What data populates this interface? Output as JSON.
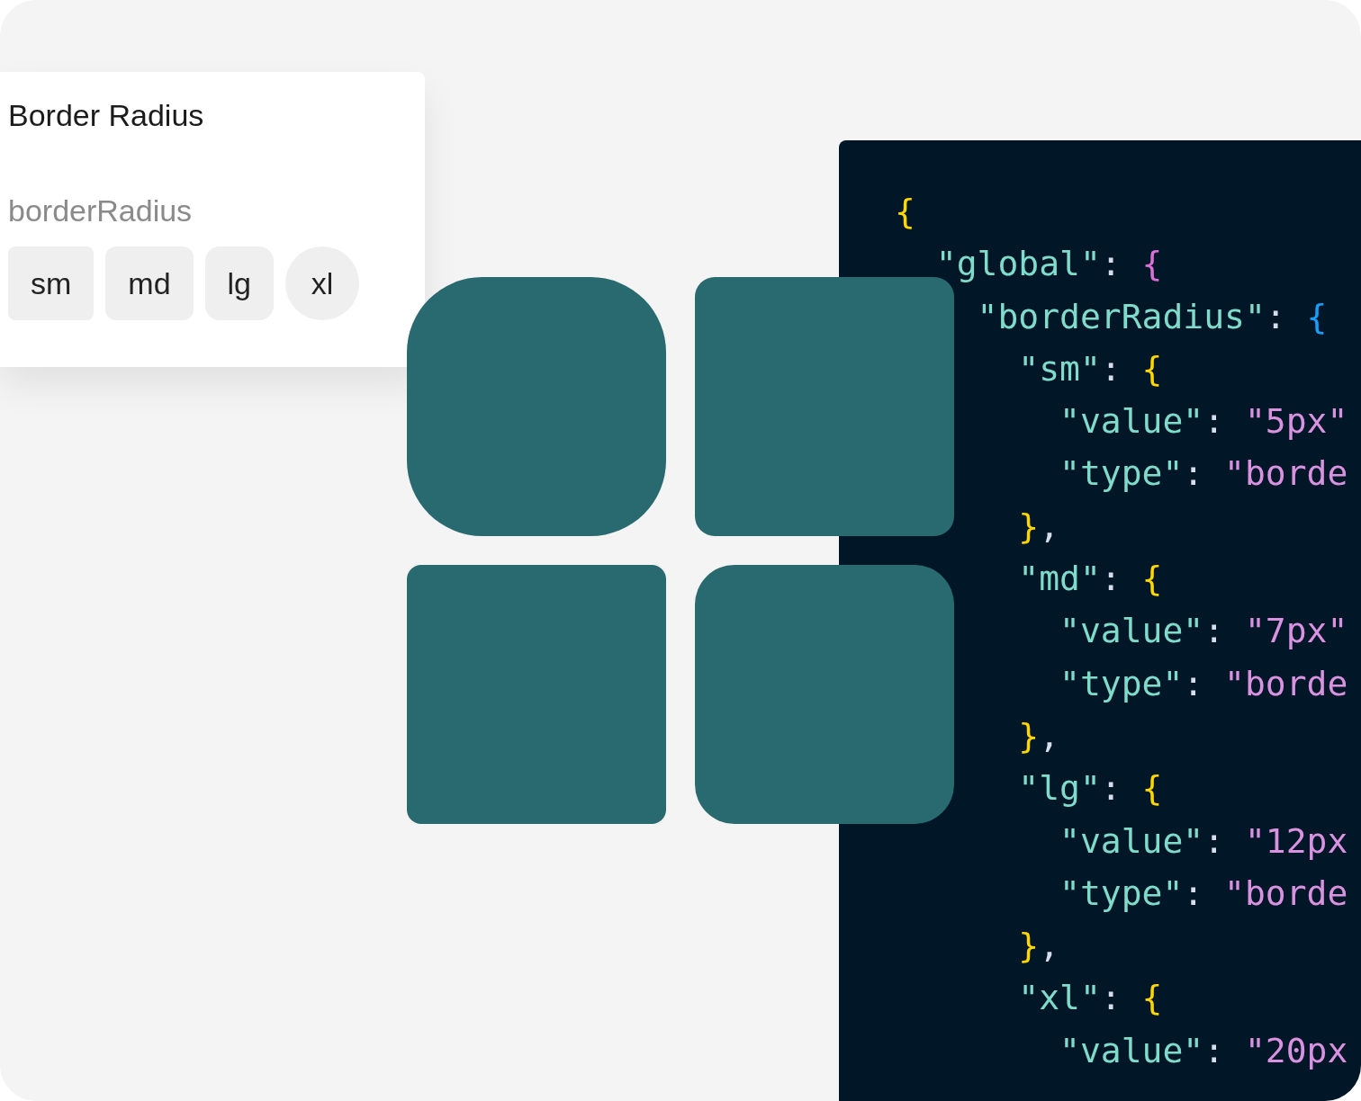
{
  "card": {
    "title": "Border Radius",
    "token_name": "borderRadius",
    "options": [
      {
        "label": "sm",
        "kind": "sm"
      },
      {
        "label": "md",
        "kind": "md"
      },
      {
        "label": "lg",
        "kind": "lg"
      },
      {
        "label": "xl",
        "kind": "xl"
      }
    ]
  },
  "tiles": [
    {
      "kind": "xl"
    },
    {
      "kind": "md"
    },
    {
      "kind": "sm"
    },
    {
      "kind": "lg"
    }
  ],
  "code": {
    "lines": [
      [
        {
          "kind": "open",
          "text": "{",
          "color": "#ffd700"
        }
      ],
      [
        {
          "kind": "key",
          "text": "\"global\""
        },
        {
          "kind": "punct",
          "text": ": "
        },
        {
          "kind": "open",
          "text": "{",
          "color": "#da70d6"
        }
      ],
      [
        {
          "kind": "key",
          "text": "\"borderRadius\""
        },
        {
          "kind": "punct",
          "text": ": "
        },
        {
          "kind": "open",
          "text": "{",
          "color": "#179fff"
        }
      ],
      [
        {
          "kind": "key",
          "text": "\"sm\""
        },
        {
          "kind": "punct",
          "text": ": "
        },
        {
          "kind": "open",
          "text": "{",
          "color": "#ffd700"
        }
      ],
      [
        {
          "kind": "key",
          "text": "\"value\""
        },
        {
          "kind": "punct",
          "text": ": "
        },
        {
          "kind": "string",
          "text": "\"5px\""
        }
      ],
      [
        {
          "kind": "key",
          "text": "\"type\""
        },
        {
          "kind": "punct",
          "text": ": "
        },
        {
          "kind": "string",
          "text": "\"borde"
        }
      ],
      [
        {
          "kind": "close",
          "text": "}",
          "color": "#ffd700"
        },
        {
          "kind": "punct",
          "text": ","
        }
      ],
      [
        {
          "kind": "key",
          "text": "\"md\""
        },
        {
          "kind": "punct",
          "text": ": "
        },
        {
          "kind": "open",
          "text": "{",
          "color": "#ffd700"
        }
      ],
      [
        {
          "kind": "key",
          "text": "\"value\""
        },
        {
          "kind": "punct",
          "text": ": "
        },
        {
          "kind": "string",
          "text": "\"7px\""
        }
      ],
      [
        {
          "kind": "key",
          "text": "\"type\""
        },
        {
          "kind": "punct",
          "text": ": "
        },
        {
          "kind": "string",
          "text": "\"borde"
        }
      ],
      [
        {
          "kind": "close",
          "text": "}",
          "color": "#ffd700"
        },
        {
          "kind": "punct",
          "text": ","
        }
      ],
      [
        {
          "kind": "key",
          "text": "\"lg\""
        },
        {
          "kind": "punct",
          "text": ": "
        },
        {
          "kind": "open",
          "text": "{",
          "color": "#ffd700"
        }
      ],
      [
        {
          "kind": "key",
          "text": "\"value\""
        },
        {
          "kind": "punct",
          "text": ": "
        },
        {
          "kind": "string",
          "text": "\"12px"
        }
      ],
      [
        {
          "kind": "key",
          "text": "\"type\""
        },
        {
          "kind": "punct",
          "text": ": "
        },
        {
          "kind": "string",
          "text": "\"borde"
        }
      ],
      [
        {
          "kind": "close",
          "text": "}",
          "color": "#ffd700"
        },
        {
          "kind": "punct",
          "text": ","
        }
      ],
      [
        {
          "kind": "key",
          "text": "\"xl\""
        },
        {
          "kind": "punct",
          "text": ": "
        },
        {
          "kind": "open",
          "text": "{",
          "color": "#ffd700"
        }
      ],
      [
        {
          "kind": "key",
          "text": "\"value\""
        },
        {
          "kind": "punct",
          "text": ": "
        },
        {
          "kind": "string",
          "text": "\"20px"
        }
      ]
    ]
  }
}
